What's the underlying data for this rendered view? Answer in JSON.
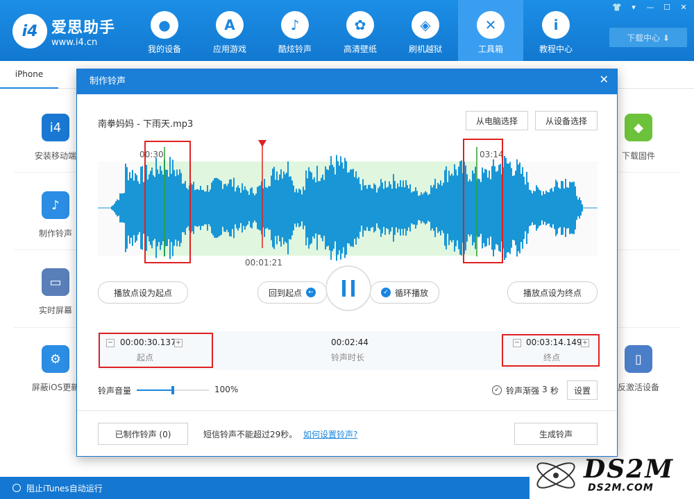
{
  "app": {
    "logo_badge": "i4",
    "title": "爱思助手",
    "url": "www.i4.cn"
  },
  "nav": [
    {
      "icon": "apple-icon",
      "glyph": "",
      "label": "我的设备"
    },
    {
      "icon": "app-store-icon",
      "glyph": "A",
      "label": "应用游戏"
    },
    {
      "icon": "bell-icon",
      "glyph": "🔔",
      "label": "酷炫铃声"
    },
    {
      "icon": "flower-icon",
      "glyph": "✿",
      "label": "高清壁纸"
    },
    {
      "icon": "box-icon",
      "glyph": "◈",
      "label": "刷机越狱"
    },
    {
      "icon": "tools-icon",
      "glyph": "✕",
      "label": "工具箱"
    },
    {
      "icon": "info-icon",
      "glyph": "i",
      "label": "教程中心"
    }
  ],
  "window_controls": [
    "👕",
    "▾",
    "—",
    "☐",
    "✕"
  ],
  "download_center": "下载中心 ⬇",
  "device_tab": "iPhone",
  "tools_left": [
    "安装移动端",
    "制作铃声",
    "实时屏幕",
    "屏蔽iOS更新"
  ],
  "tools_right": [
    "下载固件",
    "反激活设备"
  ],
  "status": {
    "itunes_block": "阻止iTunes自动运行"
  },
  "watermark": {
    "text": "DS2M",
    "sub": "DS2M.COM"
  },
  "dialog": {
    "title": "制作铃声",
    "close": "✕",
    "file_name": "南拳妈妈 - 下雨天.mp3",
    "from_pc": "从电脑选择",
    "from_device": "从设备选择",
    "marker_start": "00:30",
    "marker_end": "03:14",
    "playhead_time": "00:01:21",
    "set_start_btn": "播放点设为起点",
    "back_to_start": "回到起点",
    "loop_play": "循环播放",
    "set_end_btn": "播放点设为终点",
    "start_time": "00:00:30.137",
    "start_label": "起点",
    "duration": "00:02:44",
    "duration_label": "铃声时长",
    "end_time": "00:03:14.149",
    "end_label": "终点",
    "volume_label": "铃声音量",
    "volume_value": "100%",
    "volume_level": 0.5,
    "fade_label": "铃声渐强",
    "fade_value": "3",
    "fade_unit": "秒",
    "settings_btn": "设置",
    "made_ringtones": "已制作铃声 (0)",
    "sms_note": "短信铃声不能超过29秒。",
    "howto_link": "如何设置铃声?",
    "generate_btn": "生成铃声"
  }
}
